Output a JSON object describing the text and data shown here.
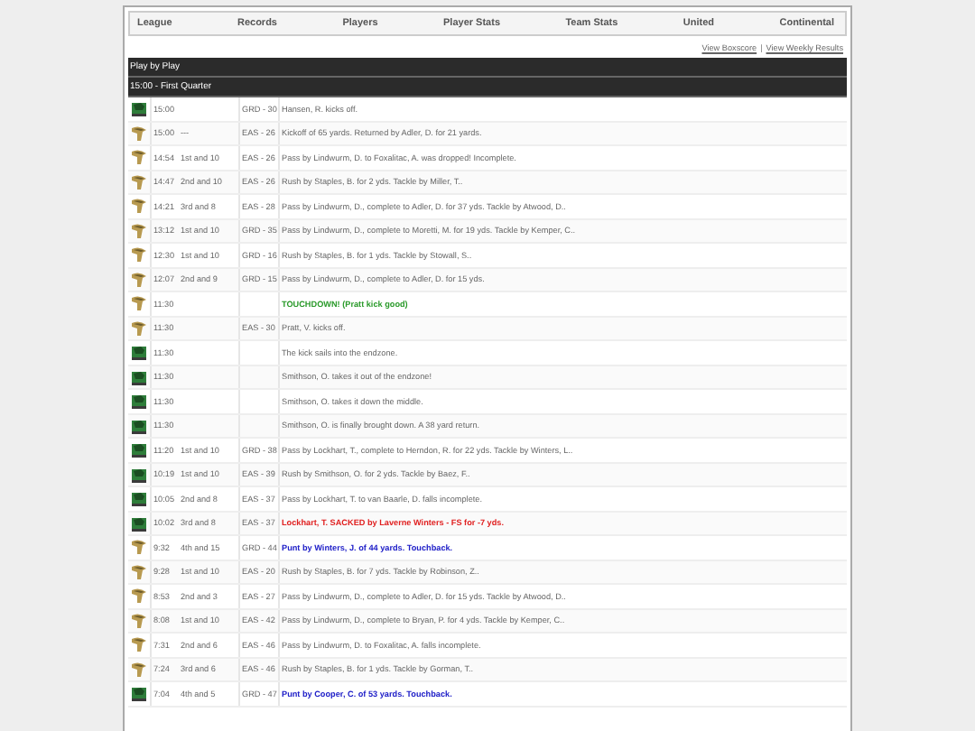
{
  "nav": [
    "League",
    "Records",
    "Players",
    "Player Stats",
    "Team Stats",
    "United",
    "Continental"
  ],
  "links": [
    "View Boxscore",
    "View Weekly Results"
  ],
  "link_separator": "|",
  "section_title": "Play by Play",
  "quarter": "15:00 - First Quarter",
  "plays": [
    {
      "icon": {
        "kind": "shield"
      },
      "kind": "plain",
      "time": "15:00",
      "spot": "GRD - 30",
      "play": "Hansen, R. kicks off."
    },
    {
      "icon": {
        "kind": "bird"
      },
      "kind": "plain",
      "time": "15:00",
      "down": "---",
      "spot": "EAS - 26",
      "play": "Kickoff of 65 yards. Returned by Adler, D. for 21 yards."
    },
    {
      "icon": {
        "kind": "bird"
      },
      "kind": "plain",
      "time": "14:54",
      "down": "1st and 10",
      "spot": "EAS - 26",
      "play": "Pass by Lindwurm, D. to Foxalitac, A. was dropped! Incomplete."
    },
    {
      "icon": {
        "kind": "bird"
      },
      "kind": "plain",
      "time": "14:47",
      "down": "2nd and 10",
      "spot": "EAS - 26",
      "play": "Rush by Staples, B. for 2 yds. Tackle by Miller, T.."
    },
    {
      "icon": {
        "kind": "bird"
      },
      "kind": "plain",
      "time": "14:21",
      "down": "3rd and 8",
      "spot": "EAS - 28",
      "play": "Pass by Lindwurm, D., complete to Adler, D. for 37 yds. Tackle by Atwood, D.."
    },
    {
      "icon": {
        "kind": "bird"
      },
      "kind": "plain",
      "time": "13:12",
      "down": "1st and 10",
      "spot": "GRD - 35",
      "play": "Pass by Lindwurm, D., complete to Moretti, M. for 19 yds. Tackle by Kemper, C.."
    },
    {
      "icon": {
        "kind": "bird"
      },
      "kind": "plain",
      "time": "12:30",
      "down": "1st and 10",
      "spot": "GRD - 16",
      "play": "Rush by Staples, B. for 1 yds. Tackle by Stowall, S.."
    },
    {
      "icon": {
        "kind": "bird"
      },
      "kind": "plain",
      "time": "12:07",
      "down": "2nd and 9",
      "spot": "GRD - 15",
      "play": "Pass by Lindwurm, D., complete to Adler, D. for 15 yds."
    },
    {
      "icon": {
        "kind": "bird"
      },
      "kind": "score",
      "time": "11:30",
      "play": "TOUCHDOWN! (Pratt kick good)"
    },
    {
      "icon": {
        "kind": "bird"
      },
      "kind": "plain",
      "time": "11:30",
      "spot": "EAS - 30",
      "play": "Pratt, V. kicks off."
    },
    {
      "icon": {
        "kind": "shield"
      },
      "kind": "plain",
      "time": "11:30",
      "play": "The kick sails into the endzone."
    },
    {
      "icon": {
        "kind": "shield"
      },
      "kind": "plain",
      "time": "11:30",
      "play": "Smithson, O. takes it out of the endzone!"
    },
    {
      "icon": {
        "kind": "shield"
      },
      "kind": "plain",
      "time": "11:30",
      "play": "Smithson, O. takes it down the middle."
    },
    {
      "icon": {
        "kind": "shield"
      },
      "kind": "plain",
      "time": "11:30",
      "play": "Smithson, O. is finally brought down. A 38 yard return."
    },
    {
      "icon": {
        "kind": "shield"
      },
      "kind": "plain",
      "time": "11:20",
      "down": "1st and 10",
      "spot": "GRD - 38",
      "play": "Pass by Lockhart, T., complete to Herndon, R. for 22 yds. Tackle by Winters, L.."
    },
    {
      "icon": {
        "kind": "shield"
      },
      "kind": "plain",
      "time": "10:19",
      "down": "1st and 10",
      "spot": "EAS - 39",
      "play": "Rush by Smithson, O. for 2 yds. Tackle by Baez, F.."
    },
    {
      "icon": {
        "kind": "shield"
      },
      "kind": "plain",
      "time": "10:05",
      "down": "2nd and 8",
      "spot": "EAS - 37",
      "play": "Pass by Lockhart, T. to van Baarle, D. falls incomplete."
    },
    {
      "icon": {
        "kind": "shield"
      },
      "kind": "sack",
      "time": "10:02",
      "down": "3rd and 8",
      "spot": "EAS - 37",
      "play": "Lockhart, T. SACKED by Laverne Winters - FS for -7 yds."
    },
    {
      "icon": {
        "kind": "bird"
      },
      "kind": "punt",
      "time": "9:32",
      "down": "4th and 15",
      "spot": "GRD - 44",
      "play": "Punt by Winters, J. of 44 yards. Touchback."
    },
    {
      "icon": {
        "kind": "bird"
      },
      "kind": "plain",
      "time": "9:28",
      "down": "1st and 10",
      "spot": "EAS - 20",
      "play": "Rush by Staples, B. for 7 yds. Tackle by Robinson, Z.."
    },
    {
      "icon": {
        "kind": "bird"
      },
      "kind": "plain",
      "time": "8:53",
      "down": "2nd and 3",
      "spot": "EAS - 27",
      "play": "Pass by Lindwurm, D., complete to Adler, D. for 15 yds. Tackle by Atwood, D.."
    },
    {
      "icon": {
        "kind": "bird"
      },
      "kind": "plain",
      "time": "8:08",
      "down": "1st and 10",
      "spot": "EAS - 42",
      "play": "Pass by Lindwurm, D., complete to Bryan, P. for 4 yds. Tackle by Kemper, C.."
    },
    {
      "icon": {
        "kind": "bird"
      },
      "kind": "plain",
      "time": "7:31",
      "down": "2nd and 6",
      "spot": "EAS - 46",
      "play": "Pass by Lindwurm, D. to Foxalitac, A. falls incomplete."
    },
    {
      "icon": {
        "kind": "bird"
      },
      "kind": "plain",
      "time": "7:24",
      "down": "3rd and 6",
      "spot": "EAS - 46",
      "play": "Rush by Staples, B. for 1 yds. Tackle by Gorman, T.."
    },
    {
      "icon": {
        "kind": "shield"
      },
      "kind": "punt",
      "time": "7:04",
      "down": "4th and 5",
      "spot": "GRD - 47",
      "play": "Punt by Cooper, C. of 53 yards. Touchback."
    }
  ]
}
